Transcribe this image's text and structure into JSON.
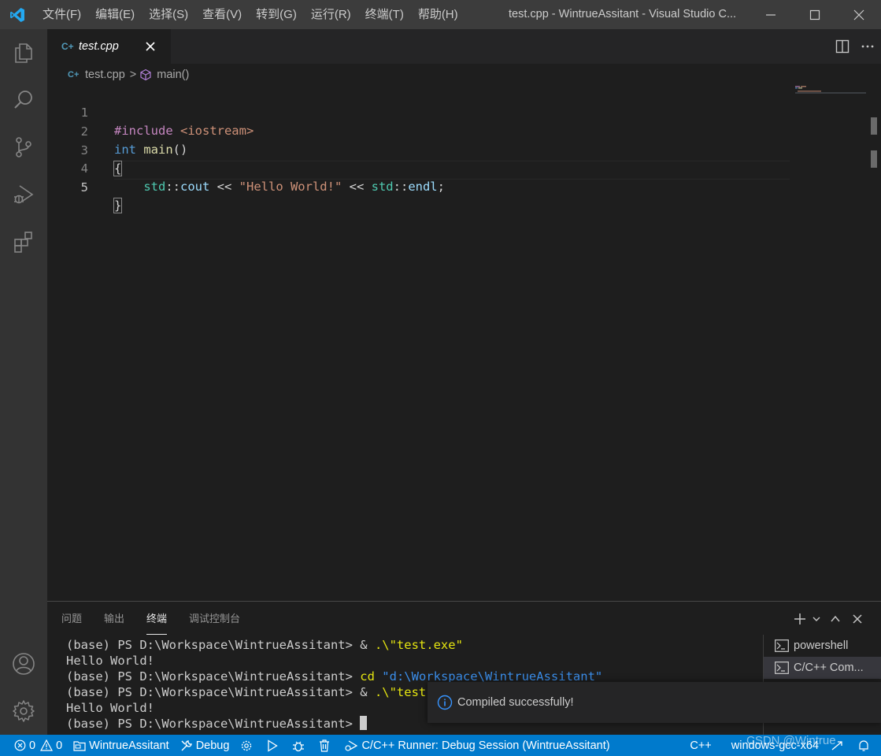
{
  "titlebar": {
    "menu": [
      "文件(F)",
      "编辑(E)",
      "选择(S)",
      "查看(V)",
      "转到(G)",
      "运行(R)",
      "终端(T)",
      "帮助(H)"
    ],
    "title": "test.cpp - WintrueAssitant - Visual Studio C..."
  },
  "tab": {
    "icon_text": "C+",
    "label": "test.cpp"
  },
  "breadcrumb": {
    "icon_text": "C+",
    "file": "test.cpp",
    "separator": ">",
    "symbol": "main()"
  },
  "editor": {
    "line_numbers": [
      "1",
      "2",
      "3",
      "4",
      "5"
    ],
    "active_line": "5",
    "lines": {
      "l1_pp": "#include",
      "l1_inc": " <iostream>",
      "l2_type": "int",
      "l2_fn": " main",
      "l2_paren": "()",
      "l3": "{",
      "l4_indent": "    ",
      "l4_ns1": "std",
      "l4_sep1": "::",
      "l4_var1": "cout",
      "l4_op1": " << ",
      "l4_str": "\"Hello World!\"",
      "l4_op2": " << ",
      "l4_ns2": "std",
      "l4_sep2": "::",
      "l4_var2": "endl",
      "l4_end": ";",
      "l5": "}"
    }
  },
  "panel": {
    "tabs": [
      "问题",
      "输出",
      "终端",
      "调试控制台"
    ],
    "active_tab": "终端",
    "terminal": {
      "line1_prompt": "(base) PS D:\\Workspace\\WintrueAssitant> & ",
      "line1_cmd": ".\\\"test.exe\"",
      "line2": "Hello World!",
      "line3_prompt": "(base) PS D:\\Workspace\\WintrueAssitant> ",
      "line3_cmd": "cd",
      "line3_arg": " \"d:\\Workspace\\WintrueAssitant\"",
      "line4_prompt": "(base) PS D:\\Workspace\\WintrueAssitant> & ",
      "line4_cmd": ".\\\"test.e",
      "line5": "Hello World!",
      "line6_prompt": "(base) PS D:\\Workspace\\WintrueAssitant> "
    },
    "terminal_list": [
      "powershell",
      "C/C++ Com..."
    ]
  },
  "notification": {
    "message": "Compiled successfully!"
  },
  "statusbar": {
    "errors": "0",
    "warnings": "0",
    "folder": "WintrueAssitant",
    "debug": "Debug",
    "runner": "C/C++ Runner: Debug Session (WintrueAssitant)",
    "language": "C++",
    "config": "windows-gcc-x64"
  },
  "watermark": "CSDN @Wintrue",
  "colors": {
    "accent": "#007acc",
    "titlebar": "#3c3c3c",
    "activitybar": "#333333",
    "editor_bg": "#1e1e1e",
    "keyword": "#569cd6",
    "string": "#ce9178",
    "function": "#dcdcaa",
    "namespace": "#4ec9b0"
  }
}
